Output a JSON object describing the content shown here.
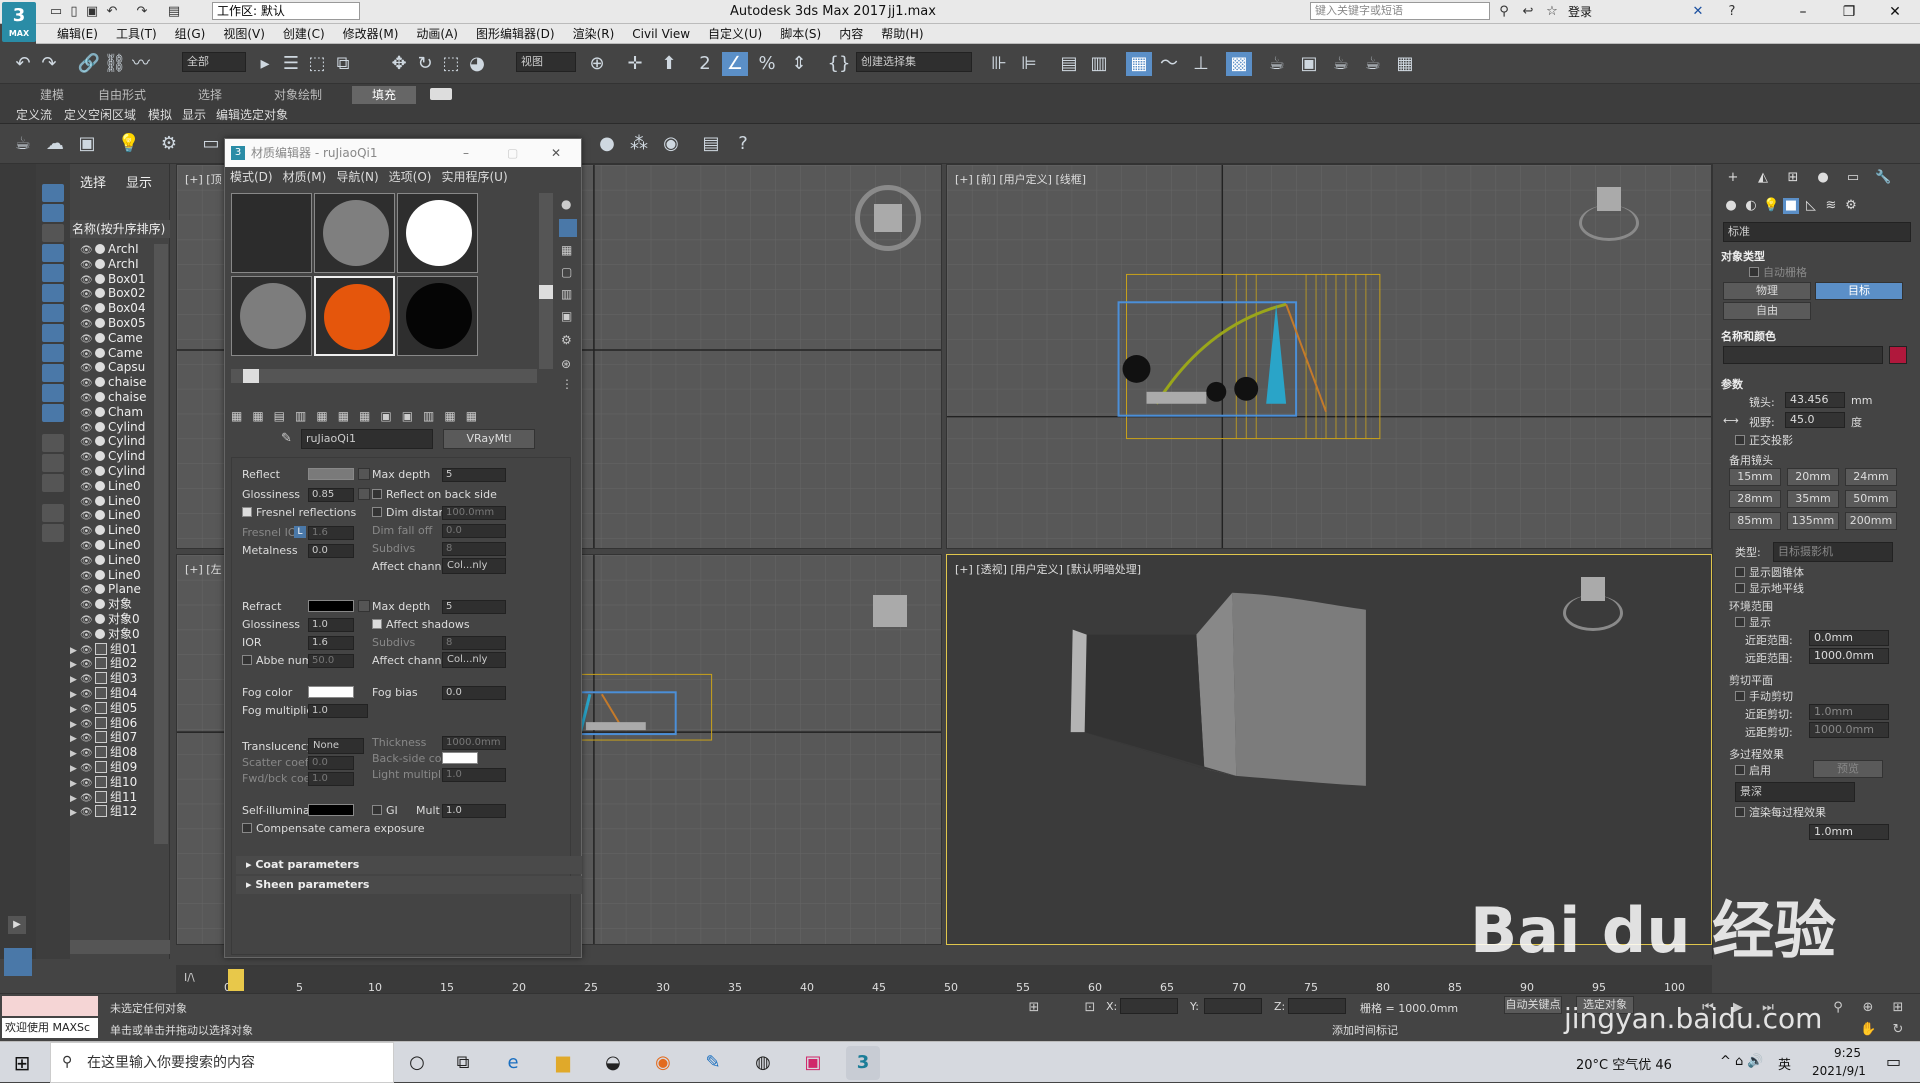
{
  "titlebar": {
    "logo": "3",
    "logo_sub": "MAX",
    "workspace": "工作区: 默认",
    "app_title": "Autodesk 3ds Max 2017",
    "file_name": "jj1.max",
    "search_placeholder": "键入关键字或短语",
    "login": "登录"
  },
  "menubar": [
    "编辑(E)",
    "工具(T)",
    "组(G)",
    "视图(V)",
    "创建(C)",
    "修改器(M)",
    "动画(A)",
    "图形编辑器(D)",
    "渲染(R)",
    "Civil View",
    "自定义(U)",
    "脚本(S)",
    "内容",
    "帮助(H)"
  ],
  "maintoolbar": {
    "selection_filter": "全部",
    "ref_coord": "视图",
    "named_selection": "创建选择集",
    "snap_value": "2.5"
  },
  "ribbon": {
    "tabs": [
      "建模",
      "自由形式",
      "选择",
      "对象绘制",
      "填充"
    ],
    "active_tab": "填充",
    "subitems": [
      "定义流",
      "定义空闲区域",
      "模拟",
      "显示",
      "编辑选定对象"
    ]
  },
  "scene_explorer": {
    "tabs": [
      "选择",
      "显示"
    ],
    "header": "名称(按升序排序)",
    "rows": [
      {
        "name": "ArchI",
        "kind": "obj"
      },
      {
        "name": "ArchI",
        "kind": "obj"
      },
      {
        "name": "Box01",
        "kind": "obj"
      },
      {
        "name": "Box02",
        "kind": "obj"
      },
      {
        "name": "Box04",
        "kind": "obj"
      },
      {
        "name": "Box05",
        "kind": "obj"
      },
      {
        "name": "Came",
        "kind": "cam"
      },
      {
        "name": "Came",
        "kind": "cam"
      },
      {
        "name": "Capsu",
        "kind": "obj"
      },
      {
        "name": "chaise",
        "kind": "obj"
      },
      {
        "name": "chaise",
        "kind": "obj"
      },
      {
        "name": "Cham",
        "kind": "obj"
      },
      {
        "name": "Cylind",
        "kind": "obj"
      },
      {
        "name": "Cylind",
        "kind": "obj"
      },
      {
        "name": "Cylind",
        "kind": "obj"
      },
      {
        "name": "Cylind",
        "kind": "obj"
      },
      {
        "name": "Line0",
        "kind": "line"
      },
      {
        "name": "Line0",
        "kind": "line"
      },
      {
        "name": "Line0",
        "kind": "line"
      },
      {
        "name": "Line0",
        "kind": "line"
      },
      {
        "name": "Line0",
        "kind": "line"
      },
      {
        "name": "Line0",
        "kind": "line"
      },
      {
        "name": "Line0",
        "kind": "line"
      },
      {
        "name": "Plane",
        "kind": "obj"
      },
      {
        "name": "对象",
        "kind": "obj"
      },
      {
        "name": "对象0",
        "kind": "obj"
      },
      {
        "name": "对象0",
        "kind": "obj"
      },
      {
        "name": "组01",
        "kind": "grp"
      },
      {
        "name": "组02",
        "kind": "grp"
      },
      {
        "name": "组03",
        "kind": "grp"
      },
      {
        "name": "组04",
        "kind": "grp"
      },
      {
        "name": "组05",
        "kind": "grp"
      },
      {
        "name": "组06",
        "kind": "grp"
      },
      {
        "name": "组07",
        "kind": "grp"
      },
      {
        "name": "组08",
        "kind": "grp"
      },
      {
        "name": "组09",
        "kind": "grp"
      },
      {
        "name": "组10",
        "kind": "grp"
      },
      {
        "name": "组11",
        "kind": "grp"
      },
      {
        "name": "组12",
        "kind": "grp"
      }
    ]
  },
  "viewports": {
    "top_left": "[+] [顶",
    "top_right": "[+] [前] [用户定义] [线框]",
    "bottom_left": "[+] [左",
    "bottom_right": "[+] [透视] [用户定义] [默认明暗处理]"
  },
  "material_editor": {
    "title": "材质编辑器 - ruJiaoQi1",
    "menu": [
      "模式(D)",
      "材质(M)",
      "导航(N)",
      "选项(O)",
      "实用程序(U)"
    ],
    "slots": [
      {
        "color": "#2c2c2c",
        "sphere": false
      },
      {
        "color": "#7f7f7f",
        "sphere": true
      },
      {
        "color": "#ffffff",
        "sphere": true
      },
      {
        "color": "#7d7d7d",
        "sphere": true
      },
      {
        "color": "#e5560c",
        "sphere": true,
        "selected": true
      },
      {
        "color": "#050505",
        "sphere": true
      }
    ],
    "material_name": "ruJiaoQi1",
    "material_type": "VRayMtl",
    "reflect": {
      "label": "Reflect",
      "glossiness_label": "Glossiness",
      "glossiness": "0.85",
      "fresnel": "Fresnel reflections",
      "fresnel_ior_label": "Fresnel IOR",
      "fresnel_ior": "1.6",
      "fresnel_lock": "L",
      "metalness_label": "Metalness",
      "metalness": "0.0",
      "max_depth_label": "Max depth",
      "max_depth": "5",
      "back_side": "Reflect on back side",
      "dim_distance": "Dim distance",
      "dim_distance_val": "100.0mm",
      "dim_falloff": "Dim fall off",
      "dim_falloff_val": "0.0",
      "subdivs": "Subdivs",
      "subdivs_val": "8",
      "affect_channels": "Affect channels",
      "affect_val": "Col...nly"
    },
    "refract": {
      "label": "Refract",
      "glossiness_label": "Glossiness",
      "glossiness": "1.0",
      "ior_label": "IOR",
      "ior": "1.6",
      "abbe": "Abbe number",
      "abbe_val": "50.0",
      "max_depth_label": "Max depth",
      "max_depth": "5",
      "affect_shadows": "Affect shadows",
      "subdivs": "Subdivs",
      "subdivs_val": "8",
      "affect_channels": "Affect channels",
      "affect_val": "Col...nly"
    },
    "fog": {
      "color_label": "Fog color",
      "mult_label": "Fog multiplier",
      "mult": "1.0",
      "bias_label": "Fog bias",
      "bias": "0.0"
    },
    "translucency": {
      "label": "Translucency",
      "value": "None",
      "scatter": "Scatter coeff",
      "scatter_val": "0.0",
      "fwd": "Fwd/bck coeff",
      "fwd_val": "1.0",
      "thickness": "Thickness",
      "thickness_val": "1000.0mm",
      "backside": "Back-side color",
      "light_mult": "Light multiplier",
      "light_mult_val": "1.0"
    },
    "self_illum": {
      "label": "Self-illumination",
      "gi": "GI",
      "mult_label": "Mult",
      "mult": "1.0",
      "compensate": "Compensate camera exposure"
    },
    "rollouts": [
      "Coat parameters",
      "Sheen parameters"
    ]
  },
  "command_panel": {
    "dropdown": "标准",
    "object_type": "对象类型",
    "auto_grid": "自动栅格",
    "buttons": [
      "物理",
      "目标",
      "自由"
    ],
    "name_color": "名称和颜色",
    "params": "参数",
    "lens_label": "镜头:",
    "lens": "43.456",
    "lens_unit": "mm",
    "fov_label": "视野:",
    "fov": "45.0",
    "fov_unit": "度",
    "ortho": "正交投影",
    "stock_lens": "备用镜头",
    "lenses": [
      "15mm",
      "20mm",
      "24mm",
      "28mm",
      "35mm",
      "50mm",
      "85mm",
      "135mm",
      "200mm"
    ],
    "type_label": "类型:",
    "type_value": "目标摄影机",
    "show_cone": "显示圆锥体",
    "show_horizon": "显示地平线",
    "env_range": "环境范围",
    "show": "显示",
    "near_range": "近距范围:",
    "near_range_val": "0.0mm",
    "far_range": "远距范围:",
    "far_range_val": "1000.0mm",
    "clip_plane": "剪切平面",
    "manual_clip": "手动剪切",
    "near_clip": "近距剪切:",
    "near_clip_val": "1.0mm",
    "far_clip": "远距剪切:",
    "far_clip_val": "1000.0mm",
    "multipass": "多过程效果",
    "enable": "启用",
    "preview": "预览",
    "effect": "景深",
    "render_effect": "渲染每过程效果",
    "target_dist_val": "1.0mm"
  },
  "timeline": {
    "frame": "0 / 100",
    "ticks": [
      "0",
      "5",
      "10",
      "15",
      "20",
      "25",
      "30",
      "35",
      "40",
      "45",
      "50",
      "55",
      "60",
      "65",
      "70",
      "75",
      "80",
      "85",
      "90",
      "95",
      "100"
    ]
  },
  "statusbar": {
    "welcome": "欢迎使用 MAXSc",
    "status1": "未选定任何对象",
    "status2": "单击或单击并拖动以选择对象",
    "x_label": "X:",
    "y_label": "Y:",
    "z_label": "Z:",
    "grid": "栅格 = 1000.0mm",
    "add_time_tag": "添加时间标记",
    "auto_key": "自动关键点",
    "selected_obj": "选定对象"
  },
  "taskbar": {
    "search": "在这里输入你要搜索的内容",
    "weather": "20°C 空气优 46",
    "ime": "英",
    "time": "9:25",
    "date": "2021/9/1"
  },
  "watermark": {
    "main": "Bai du 经验",
    "sub": "jingyan.baidu.com"
  }
}
